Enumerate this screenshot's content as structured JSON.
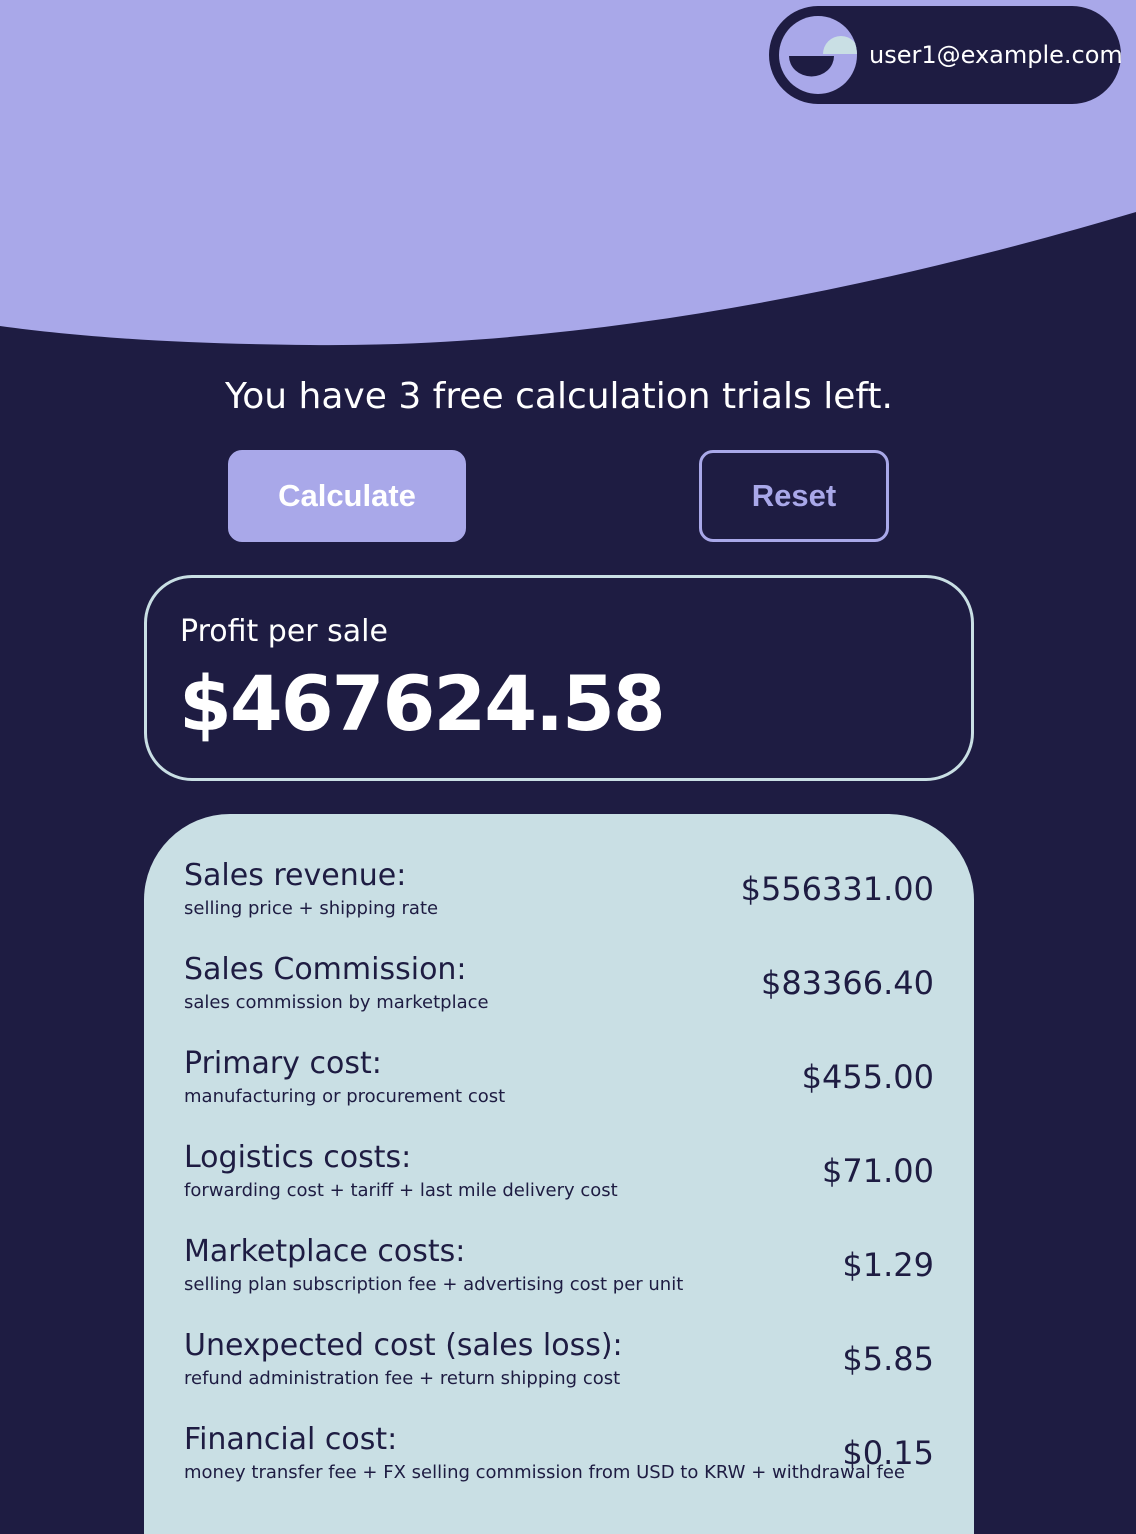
{
  "colors": {
    "background": "#1e1c42",
    "accent": "#a9a8e9",
    "card_light": "#c9dfe4",
    "text_light": "#ffffff",
    "text_dark": "#1e1c42"
  },
  "header": {
    "avatar_icon": "half-moon-logo-icon",
    "user_email": "user1@example.com"
  },
  "trials": {
    "message": "You have 3 free calculation trials left."
  },
  "actions": {
    "calculate_label": "Calculate",
    "reset_label": "Reset"
  },
  "profit": {
    "label": "Profit per sale",
    "value": "$467624.58"
  },
  "costs": [
    {
      "title": "Sales revenue:",
      "description": "selling price + shipping rate",
      "value": "$556331.00"
    },
    {
      "title": "Sales Commission:",
      "description": "sales commission by marketplace",
      "value": "$83366.40"
    },
    {
      "title": "Primary cost:",
      "description": "manufacturing or procurement cost",
      "value": "$455.00"
    },
    {
      "title": "Logistics costs:",
      "description": "forwarding cost + tariff + last mile delivery cost",
      "value": "$71.00"
    },
    {
      "title": "Marketplace costs:",
      "description": "selling plan subscription fee + advertising cost per unit",
      "value": "$1.29"
    },
    {
      "title": "Unexpected cost (sales loss):",
      "description": "refund administration fee + return shipping cost",
      "value": "$5.85"
    },
    {
      "title": "Financial cost:",
      "description": "money transfer fee + FX selling commission from USD to KRW + withdrawal fee",
      "value": "$0.15"
    }
  ]
}
